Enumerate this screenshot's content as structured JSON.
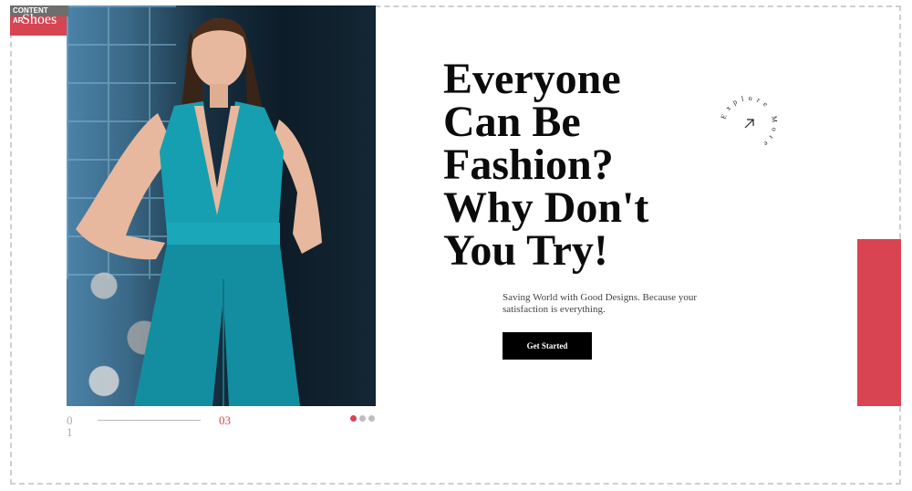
{
  "badge": {
    "area_label_line1": "CONTENT",
    "area_label_line2": "AR",
    "category": "Shoes"
  },
  "hero": {
    "image_alt": "Woman in teal halter jumpsuit"
  },
  "slider": {
    "current": "01",
    "total": "03",
    "dots": 3,
    "active_dot": 0
  },
  "headline": {
    "line1": "Everyone",
    "line2": "Can Be",
    "line3": "Fashion?",
    "line4": "Why Don't",
    "line5": "You Try!"
  },
  "tagline": "Saving World with Good Designs. Because your satisfaction is everything.",
  "cta": {
    "label": "Get Started"
  },
  "explore": {
    "text": "Explore More",
    "icon": "arrow-up-right-icon"
  },
  "colors": {
    "accent": "#d84452",
    "cta_bg": "#000000",
    "frame": "#cfcfcf"
  }
}
